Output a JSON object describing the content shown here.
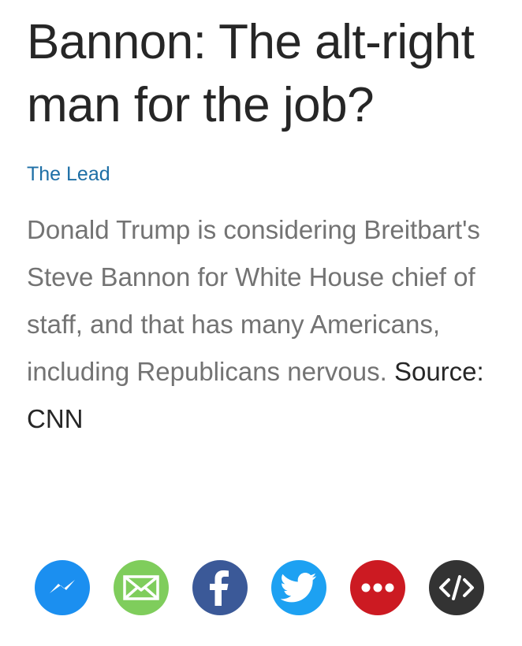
{
  "article": {
    "headline": "Bannon: The alt-right man for the job?",
    "show": "The Lead",
    "description": "Donald Trump is considering Breitbart's Steve Bannon for White House chief of staff, and that has many Americans, including Republicans nervous.",
    "source": "Source: CNN"
  },
  "share": {
    "buttons": [
      {
        "name": "messenger",
        "icon": "messenger-icon",
        "color": "#1b8ff0"
      },
      {
        "name": "email",
        "icon": "envelope-icon",
        "color": "#7fcd5c"
      },
      {
        "name": "facebook",
        "icon": "facebook-icon",
        "color": "#3b5998"
      },
      {
        "name": "twitter",
        "icon": "twitter-bird-icon",
        "color": "#1da1f2"
      },
      {
        "name": "more",
        "icon": "ellipsis-icon",
        "color": "#cc1a22"
      },
      {
        "name": "embed",
        "icon": "code-icon",
        "color": "#333333"
      }
    ]
  }
}
